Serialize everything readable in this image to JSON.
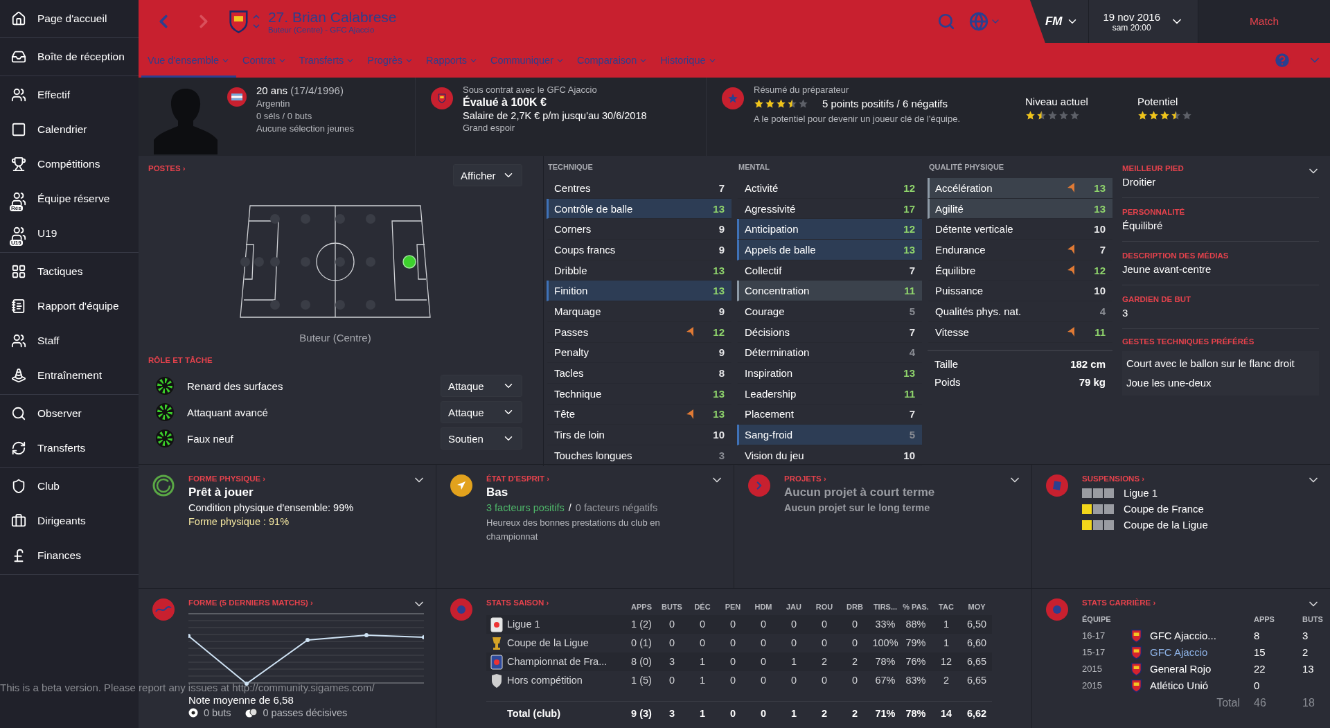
{
  "sidebar": {
    "groups": [
      [
        {
          "label": "Page d'accueil"
        }
      ],
      [
        {
          "label": "Boîte de réception"
        }
      ],
      [
        {
          "label": "Effectif"
        },
        {
          "label": "Calendrier"
        },
        {
          "label": "Compétitions"
        },
        {
          "label": "Équipe réserve",
          "badge": "Rés"
        },
        {
          "label": "U19",
          "badge": "U19"
        }
      ],
      [
        {
          "label": "Tactiques"
        },
        {
          "label": "Rapport d'équipe"
        },
        {
          "label": "Staff"
        },
        {
          "label": "Entraînement"
        }
      ],
      [
        {
          "label": "Observer"
        },
        {
          "label": "Transferts"
        }
      ],
      [
        {
          "label": "Club"
        },
        {
          "label": "Dirigeants"
        },
        {
          "label": "Finances"
        }
      ]
    ]
  },
  "header": {
    "title": "27. Brian Calabrese",
    "subtitle": "Buteur (Centre) - GFC Ajaccio",
    "brand": "FM",
    "date": "19 nov 2016",
    "time": "sam 20:00",
    "match_button": "Match"
  },
  "tabs": [
    {
      "label": "Vue d'ensemble",
      "selected": true
    },
    {
      "label": "Contrat",
      "selected": false
    },
    {
      "label": "Transferts",
      "selected": false
    },
    {
      "label": "Progrès",
      "selected": false
    },
    {
      "label": "Rapports",
      "selected": false
    },
    {
      "label": "Communiquer",
      "selected": false
    },
    {
      "label": "Comparaison",
      "selected": false
    },
    {
      "label": "Historique",
      "selected": false
    }
  ],
  "profile": {
    "age": "20 ans",
    "birth": "(17/4/1996)",
    "nationality": "Argentin",
    "caps": "0 séls / 0 buts",
    "youth": "Aucune sélection jeunes"
  },
  "contract": {
    "club_line": "Sous contrat avec le GFC Ajaccio",
    "value": "Évalué à 100K €",
    "salary": "Salaire de 2,7K € p/m jusqu'au 30/6/2018",
    "status": "Grand espoir"
  },
  "coach_report": {
    "title": "Résumé du préparateur",
    "stars": 3.5,
    "summary": "5 points positifs / 6 négatifs",
    "note": "A le potentiel pour devenir un joueur clé de l'équipe.",
    "ratings": [
      {
        "label": "Niveau actuel",
        "stars": 1.5
      },
      {
        "label": "Potentiel",
        "stars": 3.5
      }
    ]
  },
  "positions": {
    "title": "POSTES ›",
    "view_button": "Afficher",
    "position": "Buteur (Centre)"
  },
  "roles": {
    "title": "RÔLE ET TÂCHE",
    "items": [
      {
        "name": "Renard des surfaces",
        "duty": "Attaque"
      },
      {
        "name": "Attaquant avancé",
        "duty": "Attaque"
      },
      {
        "name": "Faux neuf",
        "duty": "Soutien"
      }
    ]
  },
  "attributes": [
    {
      "title": "TECHNIQUE",
      "items": [
        {
          "name": "Centres",
          "value": "7",
          "key": false,
          "marked": false,
          "trend": false
        },
        {
          "name": "Contrôle de balle",
          "value": "13",
          "key": true,
          "marked": false,
          "trend": false
        },
        {
          "name": "Corners",
          "value": "9",
          "key": false,
          "marked": false,
          "trend": false
        },
        {
          "name": "Coups francs",
          "value": "9",
          "key": false,
          "marked": false,
          "trend": false
        },
        {
          "name": "Dribble",
          "value": "13",
          "key": false,
          "marked": false,
          "trend": false
        },
        {
          "name": "Finition",
          "value": "13",
          "key": true,
          "marked": false,
          "trend": false
        },
        {
          "name": "Marquage",
          "value": "9",
          "key": false,
          "marked": false,
          "trend": false
        },
        {
          "name": "Passes",
          "value": "12",
          "key": false,
          "marked": false,
          "trend": true
        },
        {
          "name": "Penalty",
          "value": "9",
          "key": false,
          "marked": false,
          "trend": false
        },
        {
          "name": "Tacles",
          "value": "8",
          "key": false,
          "marked": false,
          "trend": false
        },
        {
          "name": "Technique",
          "value": "13",
          "key": false,
          "marked": false,
          "trend": false
        },
        {
          "name": "Tête",
          "value": "13",
          "key": false,
          "marked": false,
          "trend": true
        },
        {
          "name": "Tirs de loin",
          "value": "10",
          "key": false,
          "marked": false,
          "trend": false
        },
        {
          "name": "Touches longues",
          "value": "3",
          "key": false,
          "marked": false,
          "trend": false
        }
      ]
    },
    {
      "title": "MENTAL",
      "items": [
        {
          "name": "Activité",
          "value": "12",
          "key": false,
          "marked": false,
          "trend": false
        },
        {
          "name": "Agressivité",
          "value": "17",
          "key": false,
          "marked": false,
          "trend": false
        },
        {
          "name": "Anticipation",
          "value": "12",
          "key": true,
          "marked": false,
          "trend": false
        },
        {
          "name": "Appels de balle",
          "value": "13",
          "key": true,
          "marked": false,
          "trend": false
        },
        {
          "name": "Collectif",
          "value": "7",
          "key": false,
          "marked": false,
          "trend": false
        },
        {
          "name": "Concentration",
          "value": "11",
          "key": false,
          "marked": true,
          "trend": false
        },
        {
          "name": "Courage",
          "value": "5",
          "key": false,
          "marked": false,
          "trend": false
        },
        {
          "name": "Décisions",
          "value": "7",
          "key": false,
          "marked": false,
          "trend": false
        },
        {
          "name": "Détermination",
          "value": "4",
          "key": false,
          "marked": false,
          "trend": false
        },
        {
          "name": "Inspiration",
          "value": "13",
          "key": false,
          "marked": false,
          "trend": false
        },
        {
          "name": "Leadership",
          "value": "11",
          "key": false,
          "marked": false,
          "trend": false
        },
        {
          "name": "Placement",
          "value": "7",
          "key": false,
          "marked": false,
          "trend": false
        },
        {
          "name": "Sang-froid",
          "value": "5",
          "key": true,
          "marked": false,
          "trend": false
        },
        {
          "name": "Vision du jeu",
          "value": "10",
          "key": false,
          "marked": false,
          "trend": false
        }
      ]
    },
    {
      "title": "QUALITÉ PHYSIQUE",
      "items": [
        {
          "name": "Accélération",
          "value": "13",
          "key": false,
          "marked": true,
          "trend": true
        },
        {
          "name": "Agilité",
          "value": "13",
          "key": false,
          "marked": true,
          "trend": false
        },
        {
          "name": "Détente verticale",
          "value": "10",
          "key": false,
          "marked": false,
          "trend": false
        },
        {
          "name": "Endurance",
          "value": "7",
          "key": false,
          "marked": false,
          "trend": true
        },
        {
          "name": "Équilibre",
          "value": "12",
          "key": false,
          "marked": false,
          "trend": true
        },
        {
          "name": "Puissance",
          "value": "10",
          "key": false,
          "marked": false,
          "trend": false
        },
        {
          "name": "Qualités phys. nat.",
          "value": "4",
          "key": false,
          "marked": false,
          "trend": false
        },
        {
          "name": "Vitesse",
          "value": "11",
          "key": false,
          "marked": false,
          "trend": true
        }
      ],
      "measures": [
        {
          "label": "Taille",
          "value": "182 cm"
        },
        {
          "label": "Poids",
          "value": "79 kg"
        }
      ]
    }
  ],
  "details": {
    "sections": [
      {
        "title": "MEILLEUR PIED",
        "value": "Droitier"
      },
      {
        "title": "PERSONNALITÉ",
        "value": "Équilibré"
      },
      {
        "title": "DESCRIPTION DES MÉDIAS",
        "value": "Jeune avant-centre"
      },
      {
        "title": "GARDIEN DE BUT",
        "value": "3"
      }
    ],
    "traits_title": "GESTES TECHNIQUES PRÉFÉRÉS",
    "traits": [
      "Court avec le ballon sur le flanc droit",
      "Joue les une-deux"
    ]
  },
  "fitness": {
    "title": "FORME PHYSIQUE ›",
    "status": "Prêt à jouer",
    "condition": "Condition physique d'ensemble: 99%",
    "form": "Forme physique : 91%"
  },
  "morale": {
    "title": "ÉTAT D'ESPRIT ›",
    "status": "Bas",
    "positive": "3 facteurs positifs",
    "separator": "/",
    "negative": "0 facteurs négatifs",
    "note": "Heureux des bonnes prestations du club en championnat"
  },
  "projects": {
    "title": "PROJETS ›",
    "short_term": "Aucun projet à court terme",
    "long_term": "Aucun projet sur le long terme"
  },
  "suspensions": {
    "title": "SUSPENSIONS ›",
    "items": [
      {
        "label": "Ligue 1",
        "cards": [
          false,
          false,
          false
        ]
      },
      {
        "label": "Coupe de France",
        "cards": [
          true,
          false,
          false
        ]
      },
      {
        "label": "Coupe de la Ligue",
        "cards": [
          true,
          false,
          false
        ]
      }
    ]
  },
  "recent_form": {
    "title": "FORME (5 DERNIERS MATCHS) ›",
    "average": "Note moyenne de 6,58",
    "goals": "0 buts",
    "assists": "0 passes décisives"
  },
  "season_stats": {
    "title": "STATS SAISON ›",
    "columns": [
      "APPS",
      "BUTS",
      "DÉC",
      "PEN",
      "HDM",
      "JAU",
      "ROU",
      "DRB",
      "TIRS...",
      "% PAS.",
      "TAC",
      "MOY"
    ],
    "rows": [
      {
        "competition": "Ligue 1",
        "cells": [
          "1 (2)",
          "0",
          "0",
          "0",
          "0",
          "0",
          "0",
          "0",
          "33%",
          "88%",
          "1",
          "6,50"
        ]
      },
      {
        "competition": "Coupe de la Ligue",
        "cells": [
          "0 (1)",
          "0",
          "0",
          "0",
          "0",
          "0",
          "0",
          "0",
          "100%",
          "79%",
          "1",
          "6,60"
        ]
      },
      {
        "competition": "Championnat de Fra...",
        "cells": [
          "8 (0)",
          "3",
          "1",
          "0",
          "0",
          "1",
          "2",
          "2",
          "78%",
          "76%",
          "12",
          "6,65"
        ]
      },
      {
        "competition": "Hors compétition",
        "cells": [
          "1 (5)",
          "0",
          "1",
          "0",
          "0",
          "0",
          "0",
          "0",
          "67%",
          "83%",
          "2",
          "6,65"
        ]
      }
    ],
    "total": {
      "label": "Total (club)",
      "cells": [
        "9 (3)",
        "3",
        "1",
        "0",
        "0",
        "1",
        "2",
        "2",
        "71%",
        "78%",
        "14",
        "6,62"
      ]
    }
  },
  "career_stats": {
    "title": "STATS CARRIÈRE ›",
    "columns": [
      "ÉQUIPE",
      "APPS",
      "BUTS"
    ],
    "rows": [
      {
        "season": "16-17",
        "team": "GFC Ajaccio...",
        "apps": "8",
        "goals": "3",
        "link": false
      },
      {
        "season": "15-17",
        "team": "GFC Ajaccio",
        "apps": "15",
        "goals": "2",
        "link": true
      },
      {
        "season": "2015",
        "team": "General Rojo",
        "apps": "22",
        "goals": "13",
        "link": false
      },
      {
        "season": "2015",
        "team": "Atlético Unió",
        "apps": "0",
        "link": false
      }
    ],
    "total": {
      "label": "Total",
      "apps": "46",
      "goals": "18"
    }
  },
  "beta_notice": "This is a beta version. Please report any issues at http://community.sigames.com/"
}
